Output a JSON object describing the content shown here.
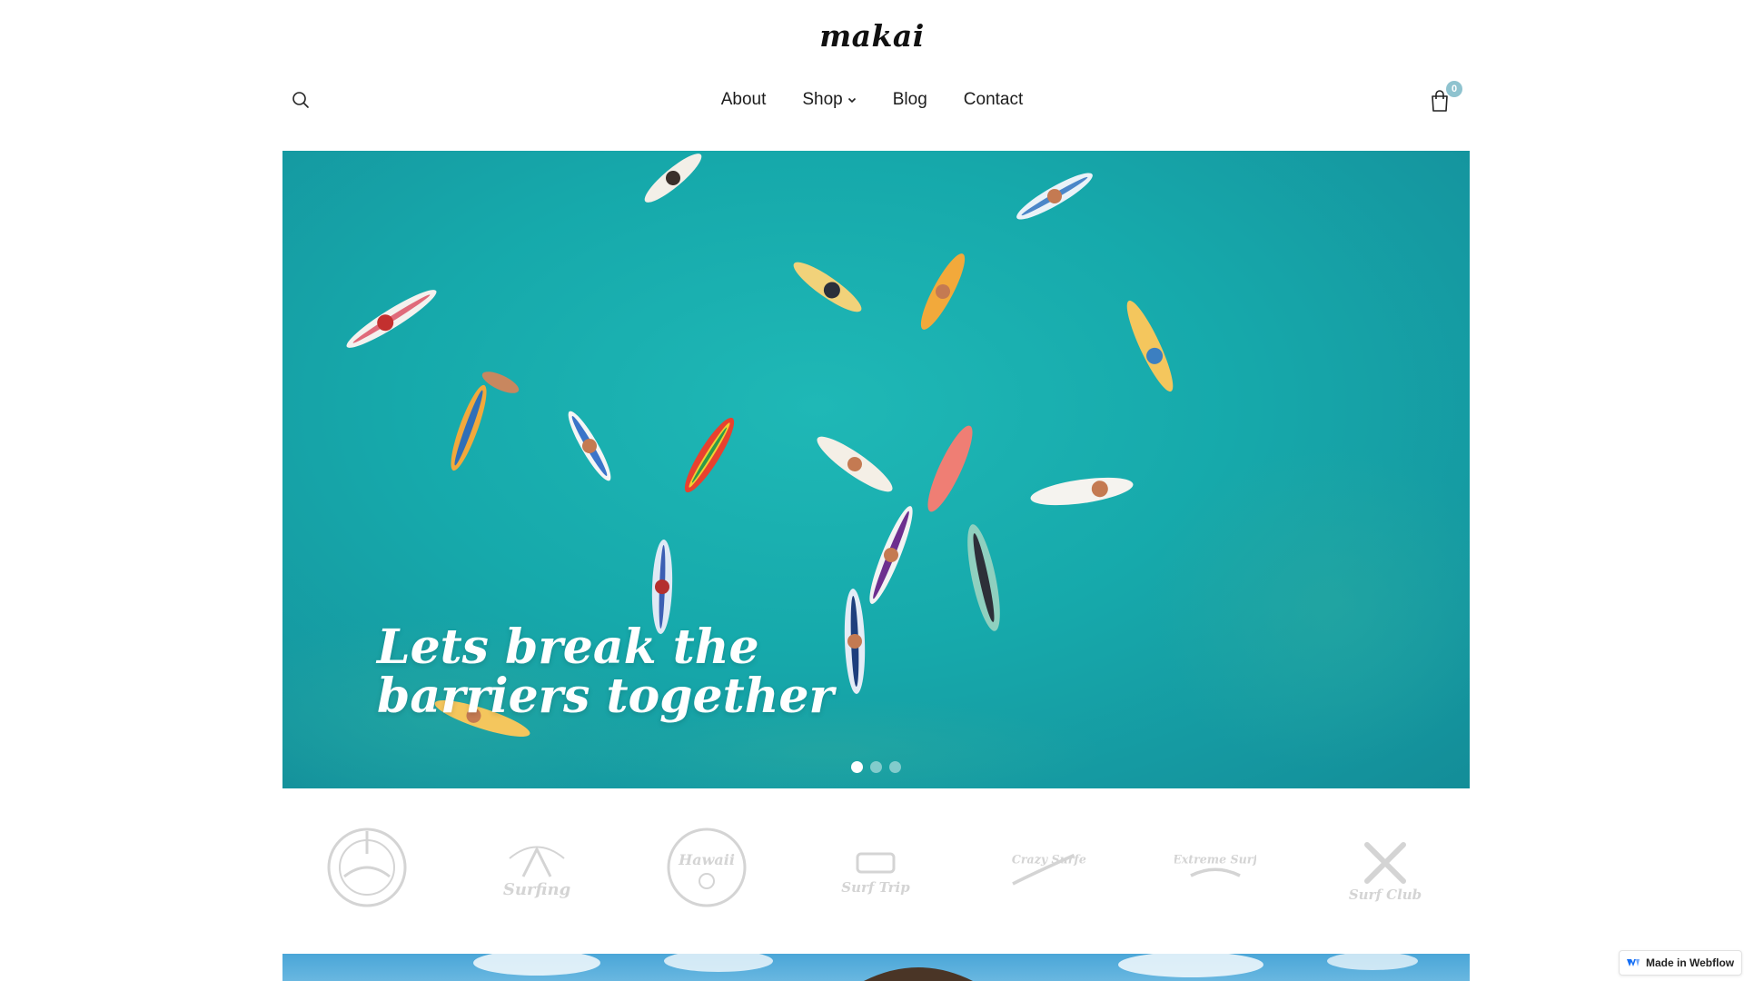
{
  "header": {
    "logo": "makai",
    "nav": [
      {
        "label": "About"
      },
      {
        "label": "Shop"
      },
      {
        "label": "Blog"
      },
      {
        "label": "Contact"
      }
    ],
    "cart_count": "0",
    "icons": {
      "search": "search-icon",
      "cart": "shopping-bag-icon",
      "shop_dropdown": "chevron-down-icon"
    }
  },
  "hero": {
    "title_line1": "Lets break the",
    "title_line2": "barriers together",
    "slides": 3,
    "active_slide": 1
  },
  "brand_logos": [
    {
      "name": "Surf badge emblem",
      "text": ""
    },
    {
      "name": "California Beach Surfing",
      "text": "Surfing"
    },
    {
      "name": "Hawaii surf badge",
      "text": "Hawaii"
    },
    {
      "name": "Summer Adventure Surf Trip",
      "text": "Surf Trip"
    },
    {
      "name": "Crazy Surfer",
      "text": "Crazy Surfer"
    },
    {
      "name": "Extreme Surf",
      "text": "Extreme Surf"
    },
    {
      "name": "Surf Club",
      "text": "Surf Club"
    }
  ],
  "badge": {
    "label": "Made in Webflow"
  },
  "colors": {
    "accent": "#8fc3cf",
    "sea": "#16a9ab",
    "text": "#1c1c1c"
  }
}
